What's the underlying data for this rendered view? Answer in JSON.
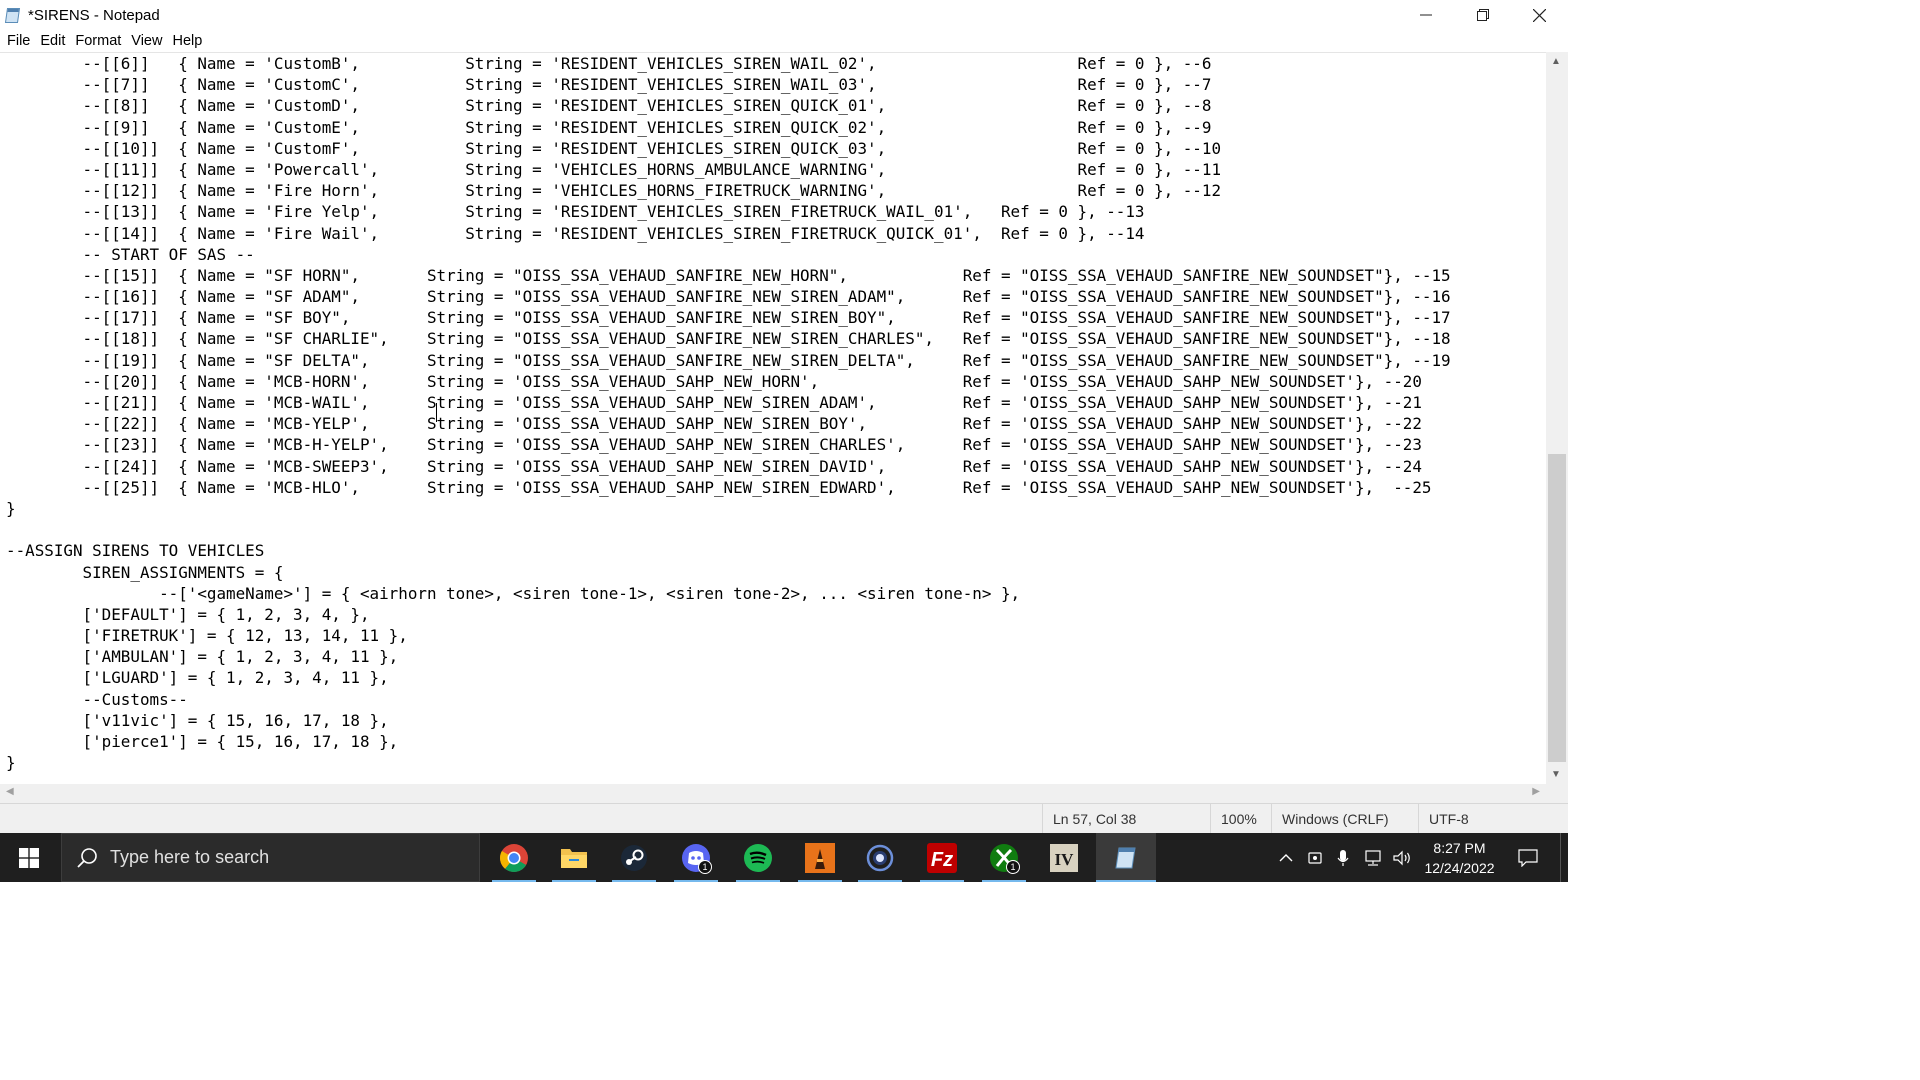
{
  "window": {
    "title": "*SIRENS - Notepad",
    "minimize_icon": "minimize-icon",
    "maximize_icon": "restore-icon",
    "close_icon": "close-icon"
  },
  "menu": {
    "items": [
      "File",
      "Edit",
      "Format",
      "View",
      "Help"
    ]
  },
  "editor": {
    "lines": [
      "        --[[6]]   { Name = 'CustomB',           String = 'RESIDENT_VEHICLES_SIREN_WAIL_02',                     Ref = 0 }, --6",
      "        --[[7]]   { Name = 'CustomC',           String = 'RESIDENT_VEHICLES_SIREN_WAIL_03',                     Ref = 0 }, --7",
      "        --[[8]]   { Name = 'CustomD',           String = 'RESIDENT_VEHICLES_SIREN_QUICK_01',                    Ref = 0 }, --8",
      "        --[[9]]   { Name = 'CustomE',           String = 'RESIDENT_VEHICLES_SIREN_QUICK_02',                    Ref = 0 }, --9",
      "        --[[10]]  { Name = 'CustomF',           String = 'RESIDENT_VEHICLES_SIREN_QUICK_03',                    Ref = 0 }, --10",
      "        --[[11]]  { Name = 'Powercall',         String = 'VEHICLES_HORNS_AMBULANCE_WARNING',                    Ref = 0 }, --11",
      "        --[[12]]  { Name = 'Fire Horn',         String = 'VEHICLES_HORNS_FIRETRUCK_WARNING',                    Ref = 0 }, --12",
      "        --[[13]]  { Name = 'Fire Yelp',         String = 'RESIDENT_VEHICLES_SIREN_FIRETRUCK_WAIL_01',   Ref = 0 }, --13",
      "        --[[14]]  { Name = 'Fire Wail',         String = 'RESIDENT_VEHICLES_SIREN_FIRETRUCK_QUICK_01',  Ref = 0 }, --14",
      "        -- START OF SAS --",
      "        --[[15]]  { Name = \"SF HORN\",       String = \"OISS_SSA_VEHAUD_SANFIRE_NEW_HORN\",            Ref = \"OISS_SSA_VEHAUD_SANFIRE_NEW_SOUNDSET\"}, --15",
      "        --[[16]]  { Name = \"SF ADAM\",       String = \"OISS_SSA_VEHAUD_SANFIRE_NEW_SIREN_ADAM\",      Ref = \"OISS_SSA_VEHAUD_SANFIRE_NEW_SOUNDSET\"}, --16",
      "        --[[17]]  { Name = \"SF BOY\",        String = \"OISS_SSA_VEHAUD_SANFIRE_NEW_SIREN_BOY\",       Ref = \"OISS_SSA_VEHAUD_SANFIRE_NEW_SOUNDSET\"}, --17",
      "        --[[18]]  { Name = \"SF CHARLIE\",    String = \"OISS_SSA_VEHAUD_SANFIRE_NEW_SIREN_CHARLES\",   Ref = \"OISS_SSA_VEHAUD_SANFIRE_NEW_SOUNDSET\"}, --18",
      "        --[[19]]  { Name = \"SF DELTA\",      String = \"OISS_SSA_VEHAUD_SANFIRE_NEW_SIREN_DELTA\",     Ref = \"OISS_SSA_VEHAUD_SANFIRE_NEW_SOUNDSET\"}, --19",
      "        --[[20]]  { Name = 'MCB-HORN',      String = 'OISS_SSA_VEHAUD_SAHP_NEW_HORN',               Ref = 'OISS_SSA_VEHAUD_SAHP_NEW_SOUNDSET'}, --20",
      "        --[[21]]  { Name = 'MCB-WAIL',      String = 'OISS_SSA_VEHAUD_SAHP_NEW_SIREN_ADAM',         Ref = 'OISS_SSA_VEHAUD_SAHP_NEW_SOUNDSET'}, --21",
      "        --[[22]]  { Name = 'MCB-YELP',      String = 'OISS_SSA_VEHAUD_SAHP_NEW_SIREN_BOY',          Ref = 'OISS_SSA_VEHAUD_SAHP_NEW_SOUNDSET'}, --22",
      "        --[[23]]  { Name = 'MCB-H-YELP',    String = 'OISS_SSA_VEHAUD_SAHP_NEW_SIREN_CHARLES',      Ref = 'OISS_SSA_VEHAUD_SAHP_NEW_SOUNDSET'}, --23",
      "        --[[24]]  { Name = 'MCB-SWEEP3',    String = 'OISS_SSA_VEHAUD_SAHP_NEW_SIREN_DAVID',        Ref = 'OISS_SSA_VEHAUD_SAHP_NEW_SOUNDSET'}, --24",
      "        --[[25]]  { Name = 'MCB-HLO',       String = 'OISS_SSA_VEHAUD_SAHP_NEW_SIREN_EDWARD',       Ref = 'OISS_SSA_VEHAUD_SAHP_NEW_SOUNDSET'},  --25",
      "}",
      "",
      "--ASSIGN SIRENS TO VEHICLES",
      "        SIREN_ASSIGNMENTS = {",
      "                --['<gameName>'] = { <airhorn tone>, <siren tone-1>, <siren tone-2>, ... <siren tone-n> },",
      "        ['DEFAULT'] = { 1, 2, 3, 4, },",
      "        ['FIRETRUK'] = { 12, 13, 14, 11 },",
      "        ['AMBULAN'] = { 1, 2, 3, 4, 11 },",
      "        ['LGUARD'] = { 1, 2, 3, 4, 11 },",
      "        --Customs--",
      "        ['v11vic'] = { 15, 16, 17, 18 },",
      "        ['pierce1'] = { 15, 16, 17, 18 },",
      "}"
    ]
  },
  "statusbar": {
    "position": "Ln 57, Col 38",
    "zoom": "100%",
    "line_endings": "Windows (CRLF)",
    "encoding": "UTF-8"
  },
  "taskbar": {
    "search_placeholder": "Type here to search",
    "apps": [
      {
        "name": "chrome-icon"
      },
      {
        "name": "file-explorer-icon"
      },
      {
        "name": "steam-icon"
      },
      {
        "name": "discord-icon",
        "badge": "1"
      },
      {
        "name": "spotify-icon"
      },
      {
        "name": "game-launcher-icon"
      },
      {
        "name": "circle-app-icon"
      },
      {
        "name": "filezilla-icon"
      },
      {
        "name": "xbox-icon",
        "badge": "1"
      },
      {
        "name": "openiv-icon"
      },
      {
        "name": "notepad-icon"
      }
    ],
    "clock": {
      "time": "8:27 PM",
      "date": "12/24/2022"
    }
  },
  "colors": {
    "taskbar_bg": "#1f1f1f",
    "accent": "#76b9ed",
    "chrome_bar": "#f0f0f0"
  }
}
